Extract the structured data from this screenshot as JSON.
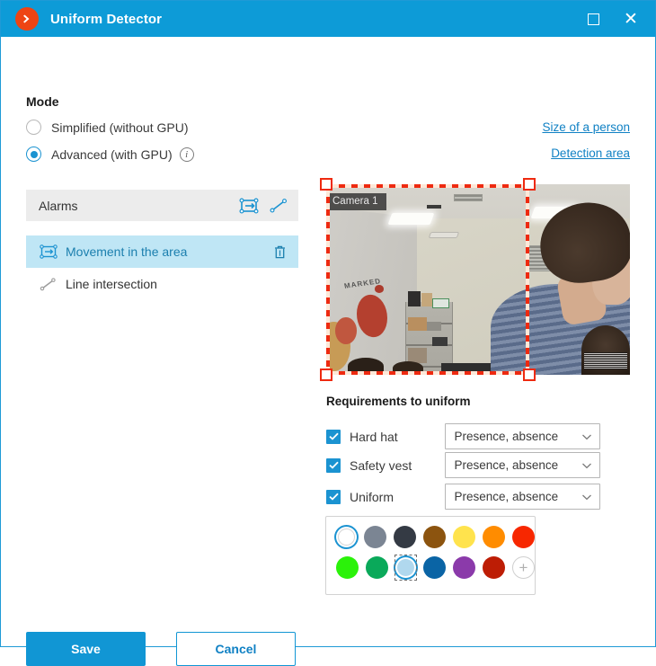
{
  "window": {
    "title": "Uniform Detector",
    "logo_icon": "chevron-right-logo-icon",
    "maximize_icon": "maximize-icon",
    "close_icon": "close-icon",
    "close_glyph": "✕",
    "accent_color": "#0d9bd7",
    "logo_color": "#ee4413"
  },
  "mode": {
    "title": "Mode",
    "options": [
      {
        "label": "Simplified (without GPU)",
        "selected": false
      },
      {
        "label": "Advanced (with GPU)",
        "selected": true,
        "info_icon": "info-icon",
        "info_glyph": "i"
      }
    ]
  },
  "links": [
    {
      "label": "Size of a person"
    },
    {
      "label": "Detection area"
    }
  ],
  "alarms": {
    "header_label": "Alarms",
    "tools": [
      {
        "name": "add-area-icon"
      },
      {
        "name": "add-line-icon"
      }
    ],
    "items": [
      {
        "label": "Movement in the area",
        "icon": "area-icon",
        "selected": true,
        "delete_icon": "trash-icon"
      },
      {
        "label": "Line intersection",
        "icon": "line-icon",
        "selected": false
      }
    ]
  },
  "video": {
    "camera_label": "Camera 1",
    "graffiti_text": "MARKED",
    "detection_rect_color": "#ee2a10"
  },
  "requirements": {
    "title": "Requirements to uniform",
    "rows": [
      {
        "label": "Hard hat",
        "checked": true,
        "value": "Presence, absence"
      },
      {
        "label": "Safety vest",
        "checked": true,
        "value": "Presence, absence"
      },
      {
        "label": "Uniform",
        "checked": true,
        "value": "Presence, absence"
      }
    ],
    "dropdown_icon": "chevron-down-icon",
    "dropdown_glyph": "⌄"
  },
  "palette": {
    "add_glyph": "+",
    "add_icon": "add-color-icon",
    "row1": [
      {
        "color": "#ffffff",
        "selected": true,
        "name": "color-white"
      },
      {
        "color": "#7b8593",
        "selected": false,
        "name": "color-gray"
      },
      {
        "color": "#343a44",
        "selected": false,
        "name": "color-dark-slate"
      },
      {
        "color": "#8c540f",
        "selected": false,
        "name": "color-brown"
      },
      {
        "color": "#ffe34d",
        "selected": false,
        "name": "color-yellow"
      },
      {
        "color": "#ff8c00",
        "selected": false,
        "name": "color-orange"
      },
      {
        "color": "#f72700",
        "selected": false,
        "name": "color-red"
      }
    ],
    "row2": [
      {
        "color": "#2bf20a",
        "selected": false,
        "name": "color-bright-green"
      },
      {
        "color": "#0aa95a",
        "selected": false,
        "name": "color-green"
      },
      {
        "color": "#b0d8ee",
        "selected": true,
        "name": "color-light-blue"
      },
      {
        "color": "#0a64a5",
        "selected": false,
        "name": "color-blue"
      },
      {
        "color": "#8b3aaa",
        "selected": false,
        "name": "color-purple"
      },
      {
        "color": "#bd1d05",
        "selected": false,
        "name": "color-dark-red"
      }
    ]
  },
  "footer": {
    "save_label": "Save",
    "cancel_label": "Cancel"
  }
}
